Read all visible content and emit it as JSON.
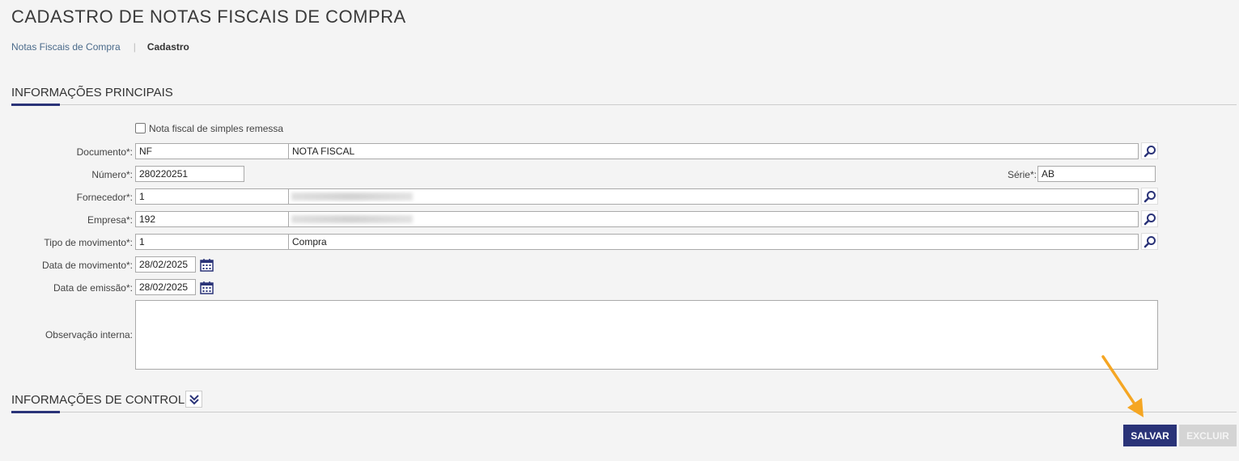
{
  "page": {
    "title": "CADASTRO DE NOTAS FISCAIS DE COMPRA"
  },
  "breadcrumb": {
    "items": [
      "Notas Fiscais de Compra",
      "Cadastro"
    ],
    "separator": "|"
  },
  "sections": {
    "main": "INFORMAÇÕES PRINCIPAIS",
    "control": "INFORMAÇÕES DE CONTROLE"
  },
  "form": {
    "simples_remessa": {
      "label": "Nota fiscal de simples remessa",
      "checked": false
    },
    "documento": {
      "label": "Documento*:",
      "code": "NF",
      "description": "NOTA FISCAL"
    },
    "numero": {
      "label": "Número*:",
      "value": "280220251"
    },
    "serie": {
      "label": "Série*:",
      "value": "AB"
    },
    "fornecedor": {
      "label": "Fornecedor*:",
      "code": "1",
      "description": ""
    },
    "empresa": {
      "label": "Empresa*:",
      "code": "192",
      "description": ""
    },
    "tipo_movimento": {
      "label": "Tipo de movimento*:",
      "code": "1",
      "description": "Compra"
    },
    "data_movimento": {
      "label": "Data de movimento*:",
      "value": "28/02/2025"
    },
    "data_emissao": {
      "label": "Data de emissão*:",
      "value": "28/02/2025"
    },
    "observacao": {
      "label": "Observação interna:",
      "value": ""
    }
  },
  "actions": {
    "save": "SALVAR",
    "delete": "EXCLUIR"
  },
  "icons": {
    "lookup": "magnifier-icon",
    "calendar": "calendar-icon",
    "expand": "double-chevron-down-icon",
    "annotation": "arrow-pointer"
  },
  "colors": {
    "primary": "#2a3378",
    "disabled": "#d4d4d4",
    "annotation_arrow": "#f5a623",
    "background": "#f4f4f4"
  }
}
